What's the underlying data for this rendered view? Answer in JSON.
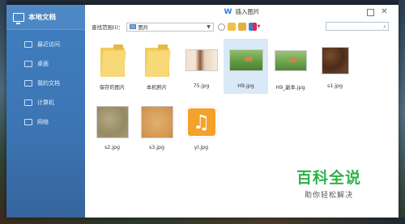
{
  "dialog": {
    "title": "插入图片",
    "app_logo": "W"
  },
  "sidebar": {
    "header": "本地文档",
    "items": [
      {
        "label": "最近访问"
      },
      {
        "label": "桌面"
      },
      {
        "label": "我的文档"
      },
      {
        "label": "计算机"
      },
      {
        "label": "网络"
      }
    ]
  },
  "toolbar": {
    "scope_label": "查找范围(I)：",
    "scope_value": "图片",
    "search_placeholder": ""
  },
  "files": [
    {
      "name": "保存的图片",
      "kind": "folder"
    },
    {
      "name": "本机照片",
      "kind": "folder"
    },
    {
      "name": "75.jpg",
      "kind": "image",
      "color": "#e7d7c4"
    },
    {
      "name": "H9.jpg",
      "kind": "image",
      "color": "#6aa04b",
      "selected": true
    },
    {
      "name": "H9_副本.jpg",
      "kind": "image",
      "color": "#77aa55"
    },
    {
      "name": "s1.jpg",
      "kind": "image",
      "color": "#5a3a24"
    },
    {
      "name": "s2.jpg",
      "kind": "image",
      "color": "#a49a72"
    },
    {
      "name": "s3.jpg",
      "kind": "image",
      "color": "#d9a765"
    },
    {
      "name": "yl.jpg",
      "kind": "music"
    }
  ],
  "watermark": {
    "title": "百科全说",
    "subtitle": "助你轻松解决"
  }
}
